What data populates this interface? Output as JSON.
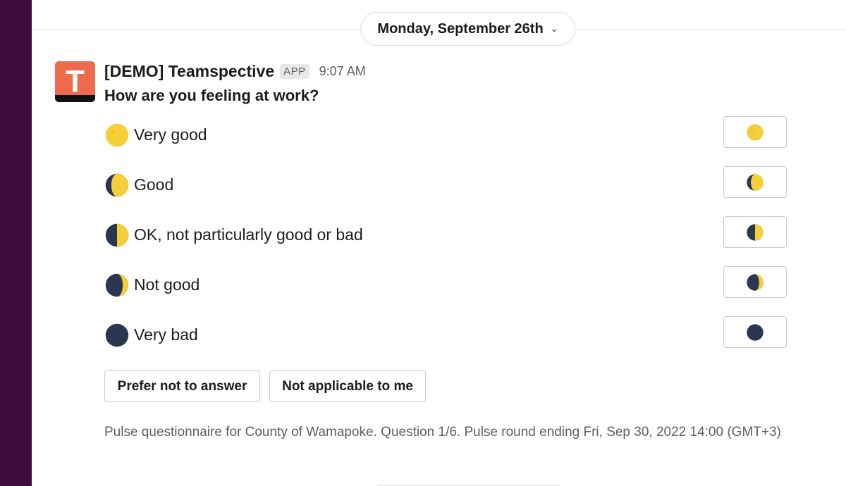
{
  "date_divider": {
    "label": "Monday, September 26th",
    "chevron": "chevron-down-icon"
  },
  "message": {
    "avatar_letter": "T",
    "sender": "[DEMO] Teamspective",
    "badge": "APP",
    "time": "9:07 AM",
    "question": "How are you feeling at work?"
  },
  "options": [
    {
      "label": "Very good",
      "icon": "full-moon-icon",
      "lit_fraction": 1.0
    },
    {
      "label": "Good",
      "icon": "waxing-gibbous-moon-icon",
      "lit_fraction": 0.75
    },
    {
      "label": "OK, not particularly good or bad",
      "icon": "first-quarter-moon-icon",
      "lit_fraction": 0.5
    },
    {
      "label": "Not good",
      "icon": "waxing-crescent-moon-icon",
      "lit_fraction": 0.25
    },
    {
      "label": "Very bad",
      "icon": "new-moon-icon",
      "lit_fraction": 0.0
    }
  ],
  "actions": {
    "prefer_not": "Prefer not to answer",
    "not_applicable": "Not applicable to me"
  },
  "footer": "Pulse questionnaire for County of Wamapoke. Question 1/6. Pulse round ending Fri, Sep 30, 2022 14:00 (GMT+3)",
  "colors": {
    "sidebar": "#3f0e40",
    "avatar": "#ee6a4d",
    "moon_light": "#f5cf38",
    "moon_dark": "#2b3652"
  }
}
